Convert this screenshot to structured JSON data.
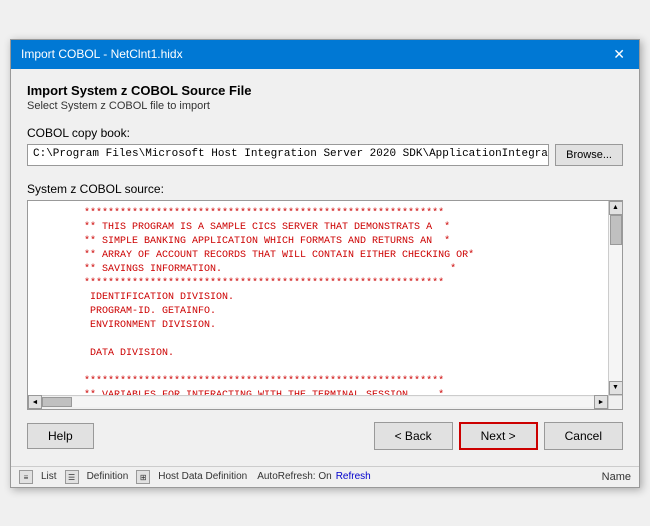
{
  "titleBar": {
    "title": "Import COBOL - NetClnt1.hidx",
    "closeLabel": "✕"
  },
  "dialog": {
    "heading": "Import System z COBOL Source File",
    "subheading": "Select System z COBOL file to import",
    "cobolLabel": "COBOL copy book:",
    "filePath": "C:\\Program Files\\Microsoft Host Integration Server 2020 SDK\\ApplicationIntegration\\WindowsInitiated\\Cics",
    "browseLabel": "Browse...",
    "sourceLabel": "System z COBOL source:",
    "sourceContent": "        ************************************************************\n        ** THIS PROGRAM IS A SAMPLE CICS SERVER THAT DEMONSTRATS A  *\n        ** SIMPLE BANKING APPLICATION WHICH FORMATS AND RETURNS AN  *\n        ** ARRAY OF ACCOUNT RECORDS THAT WILL CONTAIN EITHER CHECKING OR*\n        ** SAVINGS INFORMATION.                                      *\n        ************************************************************\n         IDENTIFICATION DIVISION.\n         PROGRAM-ID. GETAINFO.\n         ENVIRONMENT DIVISION.\n\n         DATA DIVISION.\n\n        ************************************************************\n        ** VARIABLES FOR INTERACTING WITH THE TERMINAL SESSION     *"
  },
  "buttons": {
    "helpLabel": "Help",
    "backLabel": "< Back",
    "nextLabel": "Next >",
    "cancelLabel": "Cancel"
  },
  "statusBar": {
    "listIcon": "≡",
    "listLabel": "List",
    "definitionIcon": "☰",
    "definitionLabel": "Definition",
    "hostDataIcon": "⊞",
    "hostDataLabel": "Host Data Definition",
    "autoRefreshLabel": "AutoRefresh: On",
    "refreshLabel": "Refresh",
    "nameLabel": "Name"
  }
}
